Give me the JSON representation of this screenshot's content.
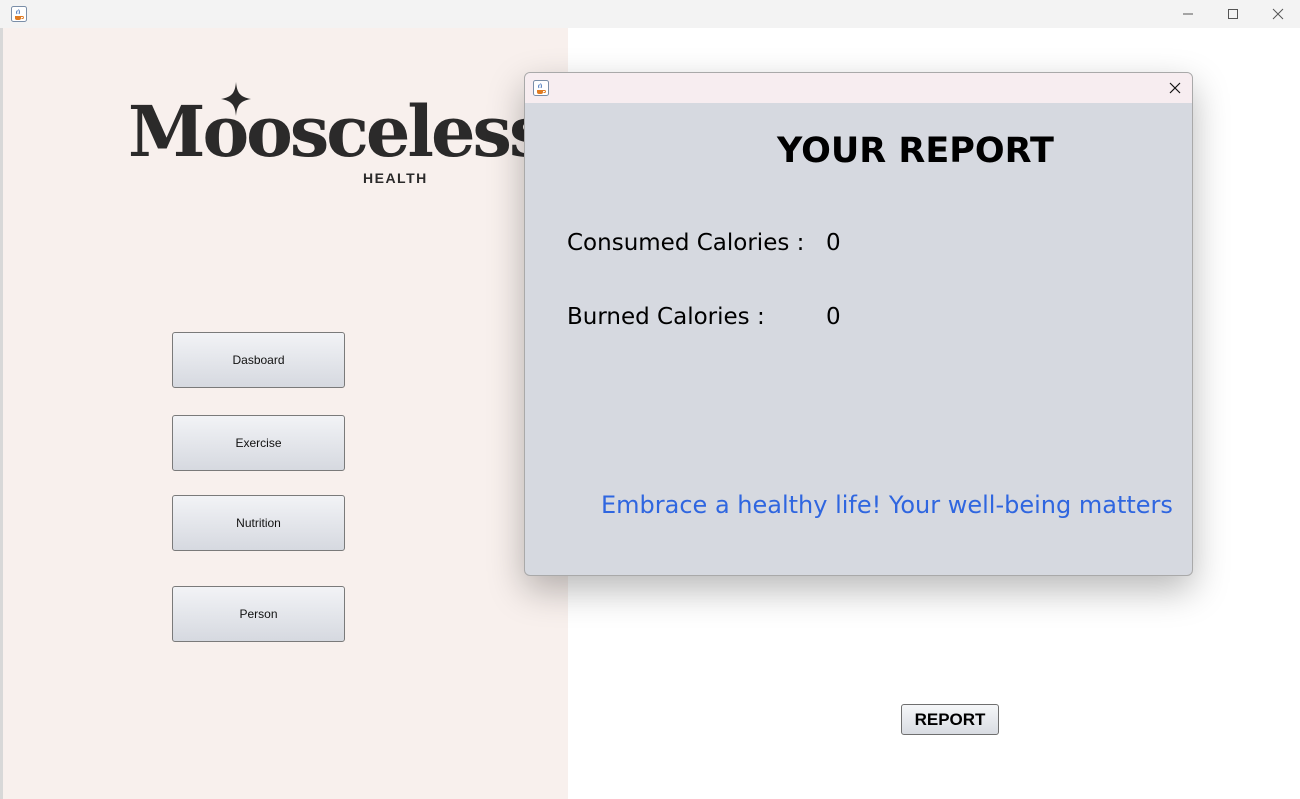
{
  "window": {
    "title": "",
    "icon": "java-coffee-icon",
    "controls": {
      "minimize": "—",
      "maximize": "☐",
      "close": "✕"
    }
  },
  "sidebar": {
    "logo": {
      "brand": "Moosceless",
      "tagline": "HEALTH"
    },
    "buttons": [
      {
        "label": "Dasboard"
      },
      {
        "label": "Exercise"
      },
      {
        "label": "Nutrition"
      },
      {
        "label": "Person"
      }
    ]
  },
  "main": {
    "report_button": "REPORT"
  },
  "dialog": {
    "title": "YOUR REPORT",
    "rows": [
      {
        "label": "Consumed Calories :",
        "value": "0"
      },
      {
        "label": "Burned Calories :",
        "value": "0"
      }
    ],
    "motto": "Embrace a healthy life! Your well-being matters",
    "close": "✕"
  },
  "colors": {
    "sidebar_bg": "#f8f0ed",
    "dialog_bg": "#d6d9e0",
    "dialog_titlebar": "#f7edf0",
    "motto_blue": "#2f66e0",
    "logo_dark": "#2b2a2a"
  }
}
